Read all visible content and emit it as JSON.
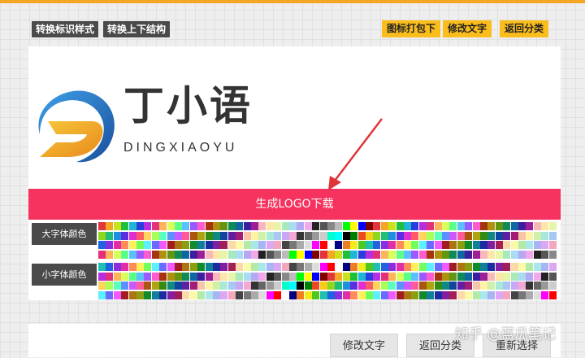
{
  "toolbar": {
    "convert_style_label": "转换标识样式",
    "convert_layout_label": "转换上下结构",
    "pack_icon_label": "图标打包下",
    "edit_text_label": "修改文字",
    "back_category_label": "返回分类"
  },
  "logo": {
    "title": "丁小语",
    "subtitle": "DINGXIAOYU",
    "mark_letter": "D"
  },
  "generate_button": "生成LOGO下载",
  "color_rows": [
    {
      "label": "大字体颜色"
    },
    {
      "label": "小字体颜色"
    }
  ],
  "bottom_actions": {
    "edit_text_label": "修改文字",
    "back_category_label": "返回分类",
    "reselect_label": "重新选择"
  },
  "watermark": "知乎 @蓝瓜笔记",
  "colors": {
    "accent": "#f6325e",
    "toolbar_yellow": "#fbbd1c",
    "toolbar_dark": "#4a4a4a",
    "top_border": "#f5a623",
    "logo_blue": "#1f6fc4",
    "logo_orange": "#f0a020"
  },
  "palette": [
    "#e2363c",
    "#ec4a1e",
    "#f07d1f",
    "#f5a623",
    "#f8cc1b",
    "#f4ea1c",
    "#c9e21c",
    "#8fd61e",
    "#4ec81f",
    "#1ebf3b",
    "#1fbf7a",
    "#1fc0b2",
    "#1fb5d6",
    "#1f8fe0",
    "#1f63e0",
    "#2a3ee0",
    "#5a2ee0",
    "#8a2ee0",
    "#b62ee0",
    "#de2ed4",
    "#e22ea6",
    "#e2307a",
    "#ff5a66",
    "#ff8a5a",
    "#ffb35a",
    "#ffd45a",
    "#fff05a",
    "#d8ff5a",
    "#a8ff5a",
    "#70ff5a",
    "#5aff86",
    "#5affc0",
    "#5af0ff",
    "#5ac0ff",
    "#5a90ff",
    "#6a6aff",
    "#9a5aff",
    "#c85aff",
    "#f05aff",
    "#ff5ad0",
    "#ff5a9a",
    "#a11c22",
    "#a6340f",
    "#a9560f",
    "#ad7512",
    "#b0910f",
    "#aea40f",
    "#8c9d10",
    "#629510",
    "#338b10",
    "#108a2a",
    "#108a56",
    "#108a80",
    "#10809a",
    "#1066a0",
    "#1046a0",
    "#1a2ca0",
    "#3e1ea0",
    "#621ea0",
    "#821ea0",
    "#9e1e98",
    "#a21e76",
    "#a21e56",
    "#f7b7bb",
    "#f9c5a8",
    "#fbd9a8",
    "#fde7a8",
    "#fef4a8",
    "#fbfaa8",
    "#e7f5a8",
    "#cff0a8",
    "#b3eaa8",
    "#a8e8bd",
    "#a8e8d8",
    "#a8e8ea",
    "#a8dcf0",
    "#a8c8f3",
    "#a8b4f3",
    "#b4a8f3",
    "#c8a8f3",
    "#dca8f3",
    "#f0a8ea",
    "#f3a8d4",
    "#f3a8bd",
    "#222222",
    "#333333",
    "#444444",
    "#555555",
    "#666666",
    "#777777",
    "#888888",
    "#999999",
    "#aaaaaa",
    "#bbbbbb",
    "#cccccc",
    "#dddddd",
    "#00ff00",
    "#00ffcc",
    "#ff00ff",
    "#ffff00",
    "#00ffff",
    "#ff0000",
    "#0000ff",
    "#000000",
    "#ffffff",
    "#800000",
    "#008000",
    "#000080"
  ]
}
